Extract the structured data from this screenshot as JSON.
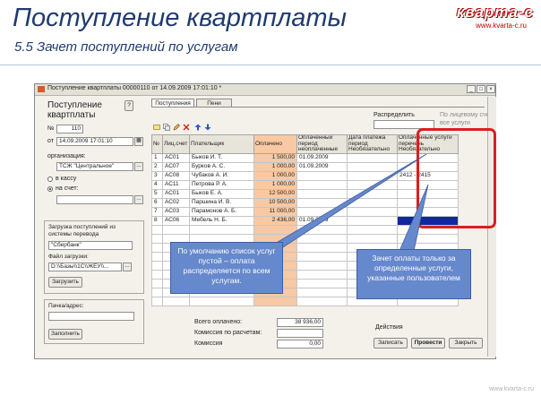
{
  "slide": {
    "title": "Поступление квартплаты",
    "subtitle": "5.5  Зачет поступлений по услугам",
    "logo_main": "кварта-с",
    "logo_sub": "www.kvarta-c.ru",
    "slide_number": "www.kvarta-c.ru"
  },
  "window": {
    "title": "Поступление квартплаты 00000110 от 14.09.2009 17:01:10 *",
    "icon": "document-icon",
    "controls": [
      "_",
      "□",
      "×"
    ]
  },
  "left_panel": {
    "heading_line1": "Поступление",
    "heading_line2": "квартплаты",
    "help": "?",
    "number_label": "№",
    "number_value": "110",
    "date_label": "от",
    "date_value": "14.09.2009 17:01:10",
    "org_label": "организация:",
    "org_value": "ТСЖ \"Центральное\"",
    "radio_cash": "в кассу",
    "radio_account": "на счет:",
    "radio_selected": "account",
    "account_value": "",
    "load_label_line1": "Загрузка поступлений из",
    "load_label_line2": "системы перевода",
    "load_system_value": "\"Сбербанк\"",
    "file_label": "Файл загрузки:",
    "file_value": "D:\\\\Базы\\\\1С\\\\ЖЕУ\\\\...",
    "load_button": "Загрузить",
    "comment_label": "Пачка/адрес:",
    "comment_value": "",
    "fill_button": "Заполнить"
  },
  "tabs": [
    {
      "label": "Поступления",
      "active": true
    },
    {
      "label": "Пени",
      "active": false
    }
  ],
  "toolbar": {
    "icons": [
      "add-row-icon",
      "copy-row-icon",
      "edit-row-icon",
      "delete-row-icon",
      "up-arrow-icon",
      "down-arrow-icon"
    ],
    "distribute_label": "Распределить",
    "distribute_value": "",
    "bank_label_line1": "По лицевому счету",
    "bank_label_line2": "все услуги"
  },
  "table": {
    "headers": [
      "№",
      "Лиц.счет",
      "Плательщик",
      "Оплачено",
      "Оплаченный период неоплаченные",
      "Дата платежа период Необязательно",
      "Оплаченные услуги перечень Необязательно"
    ],
    "rows": [
      [
        "1",
        "АС01",
        "Быков И. Т.",
        "1 500,00",
        "01.09.2009",
        "",
        ""
      ],
      [
        "2",
        "АС07",
        "Бурков А. С.",
        "1 000,00",
        "01.09.2009",
        "",
        ""
      ],
      [
        "3",
        "АС08",
        "Чубаков А. И.",
        "1 000,00",
        "",
        "",
        "2412 - 2415"
      ],
      [
        "4",
        "АС11",
        "Петрова Р. А.",
        "1 000,00",
        "",
        "",
        ""
      ],
      [
        "5",
        "АС01",
        "Быков Е. А.",
        "12 500,00",
        "",
        "",
        ""
      ],
      [
        "6",
        "АС02",
        "Паршина И. В.",
        "10 500,00",
        "",
        "",
        ""
      ],
      [
        "7",
        "АС03",
        "Парамонов А. Б.",
        "11 000,00",
        "",
        "",
        ""
      ],
      [
        "8",
        "АС06",
        "Мебель Н. Б.",
        "2 436,00",
        "01.09.2009",
        "",
        ""
      ]
    ],
    "selected_row": 8
  },
  "totals": {
    "total_label": "Всего оплачено:",
    "total_value": "38 936,00",
    "commission_label": "Комиссия по расчетам:",
    "commission_value": "",
    "fee_label": "Комиссия",
    "fee_value": "0,00",
    "actions_label": "Действия",
    "record_button": "Записать",
    "post_button": "Провести",
    "close_button": "Закрыть"
  },
  "callouts": {
    "left": "По умолчанию список услуг пустой – оплата распределяется по всем услугам.",
    "right": "Зачет оплаты только за определенные услуги, указанные пользователем"
  },
  "colors": {
    "title": "#1f3b6e",
    "highlight": "#d9201e",
    "callout_fill": "#6688cc",
    "accent_column": "#f8c9a3",
    "selection": "#10299a"
  }
}
